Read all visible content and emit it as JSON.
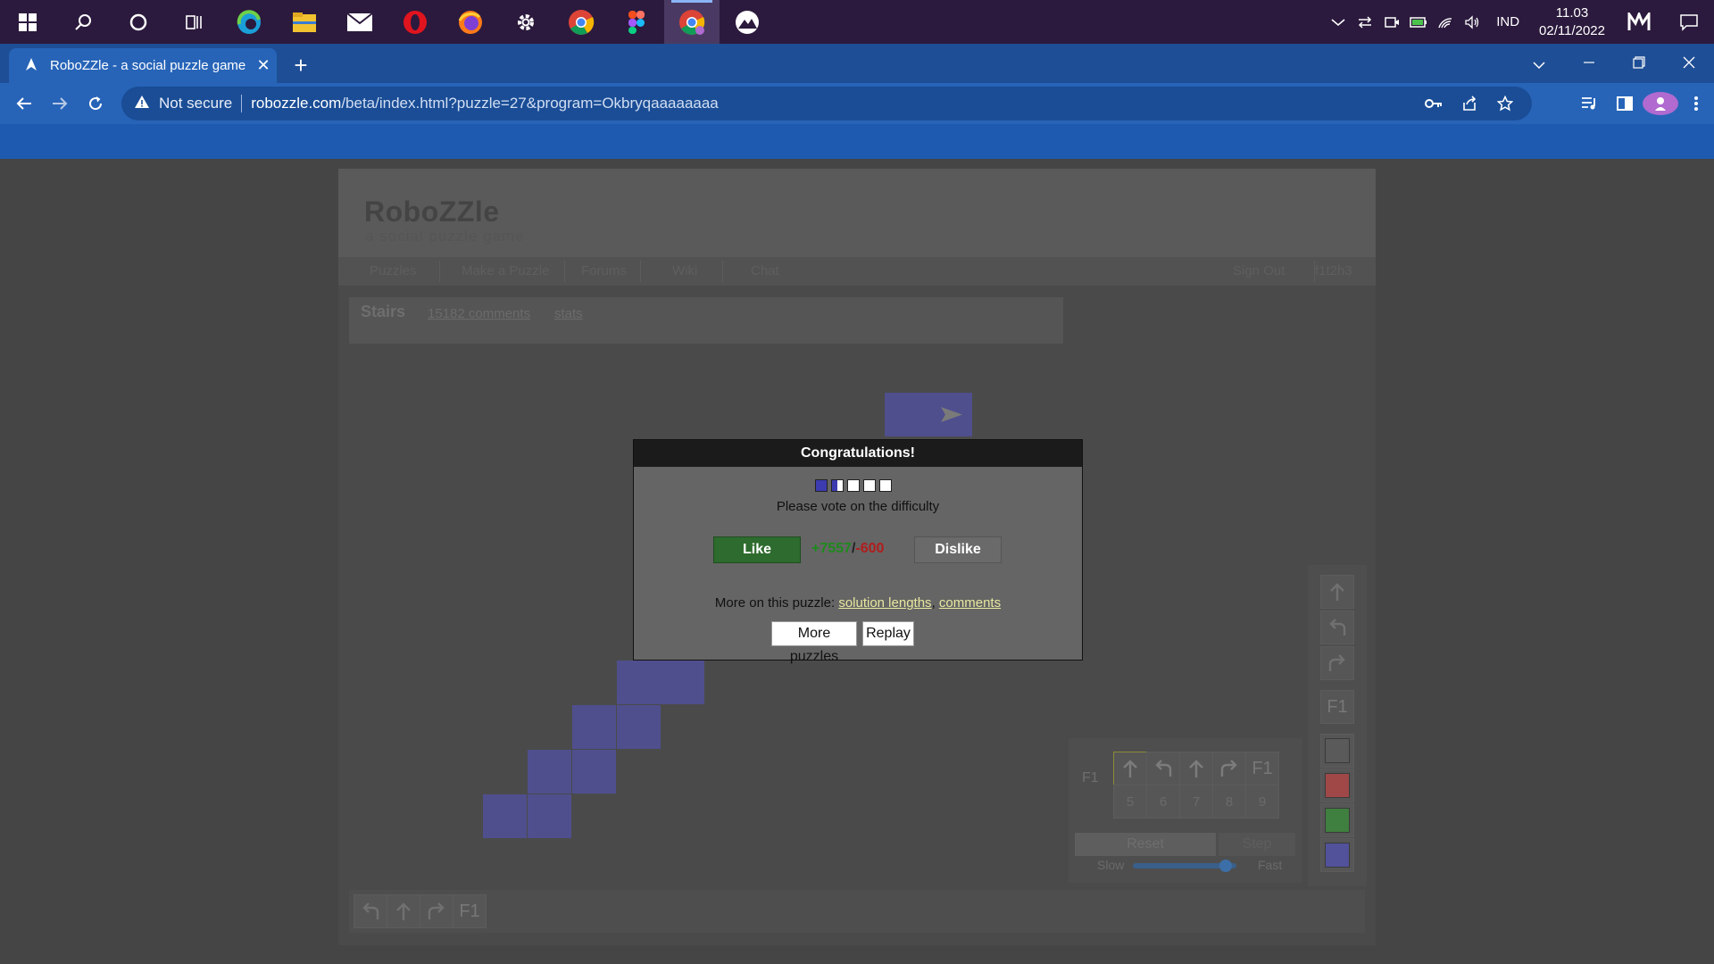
{
  "taskbar": {
    "lang": "IND",
    "time": "11.03",
    "date": "02/11/2022"
  },
  "browser": {
    "tab_title": "RoboZZle - a social puzzle game",
    "security_label": "Not secure",
    "url_host": "robozzle.com",
    "url_path": "/beta/index.html?puzzle=27&program=Okbryqaaaaaaaa"
  },
  "site": {
    "logo": "RoboZZle",
    "tagline": "a social puzzle game",
    "menu": [
      "Puzzles",
      "Make a Puzzle",
      "Forums",
      "Wiki",
      "Chat"
    ],
    "menu_right": [
      "Sign Out",
      "f1t2h3"
    ]
  },
  "puzzle": {
    "title": "Stairs",
    "comments_link": "15182 comments",
    "stats_link": "stats"
  },
  "program": {
    "function_label": "F1",
    "slot_numbers": [
      "5",
      "6",
      "7",
      "8",
      "9"
    ],
    "slot_f1": "F1",
    "reset_label": "Reset",
    "step_label": "Step",
    "slow_label": "Slow",
    "fast_label": "Fast",
    "speed": 0.9
  },
  "toolbox": {
    "f1_label": "F1",
    "colors": [
      "#5a5a5a",
      "#a04848",
      "#3f7f3f",
      "#52529a"
    ]
  },
  "bottom": {
    "f1_label": "F1"
  },
  "modal": {
    "title": "Congratulations!",
    "vote_text": "Please vote on the difficulty",
    "difficulty": 1.5,
    "like_label": "Like",
    "likes": "+7557",
    "slash": "/",
    "dislikes": "-600",
    "dislike_label": "Dislike",
    "more_text": "More on this puzzle: ",
    "solution_lengths": "solution lengths",
    "comma": ", ",
    "comments": "comments",
    "more_puzzles_label": "More puzzles",
    "replay_label": "Replay"
  }
}
